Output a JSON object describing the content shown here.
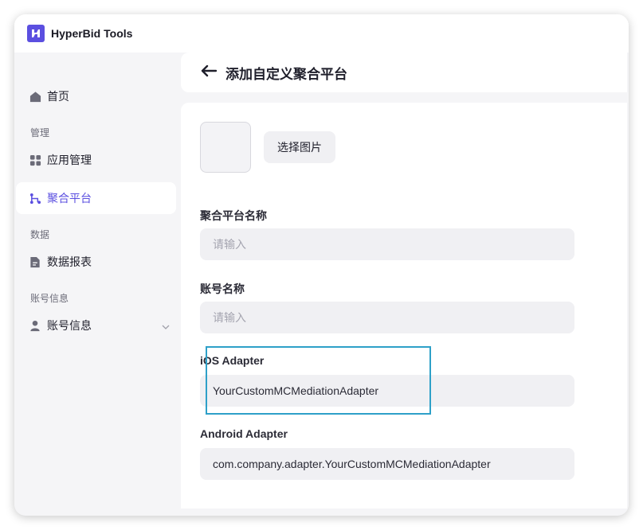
{
  "app": {
    "brand": "HyperBid Tools"
  },
  "sidebar": {
    "home": "首页",
    "group_manage": "管理",
    "apps": "应用管理",
    "mediation": "聚合平台",
    "group_data": "数据",
    "reports": "数据报表",
    "group_account": "账号信息",
    "account": "账号信息"
  },
  "header": {
    "title": "添加自定义聚合平台"
  },
  "form": {
    "pick_image": "选择图片",
    "platform_name": {
      "label": "聚合平台名称",
      "placeholder": "请输入",
      "value": ""
    },
    "account_name": {
      "label": "账号名称",
      "placeholder": "请输入",
      "value": ""
    },
    "ios_adapter": {
      "label": "iOS Adapter",
      "value": "YourCustomMCMediationAdapter"
    },
    "android_adapter": {
      "label": "Android Adapter",
      "value": "com.company.adapter.YourCustomMCMediationAdapter"
    }
  },
  "colors": {
    "accent": "#5b4fe0",
    "highlight": "#2ea0c8"
  }
}
